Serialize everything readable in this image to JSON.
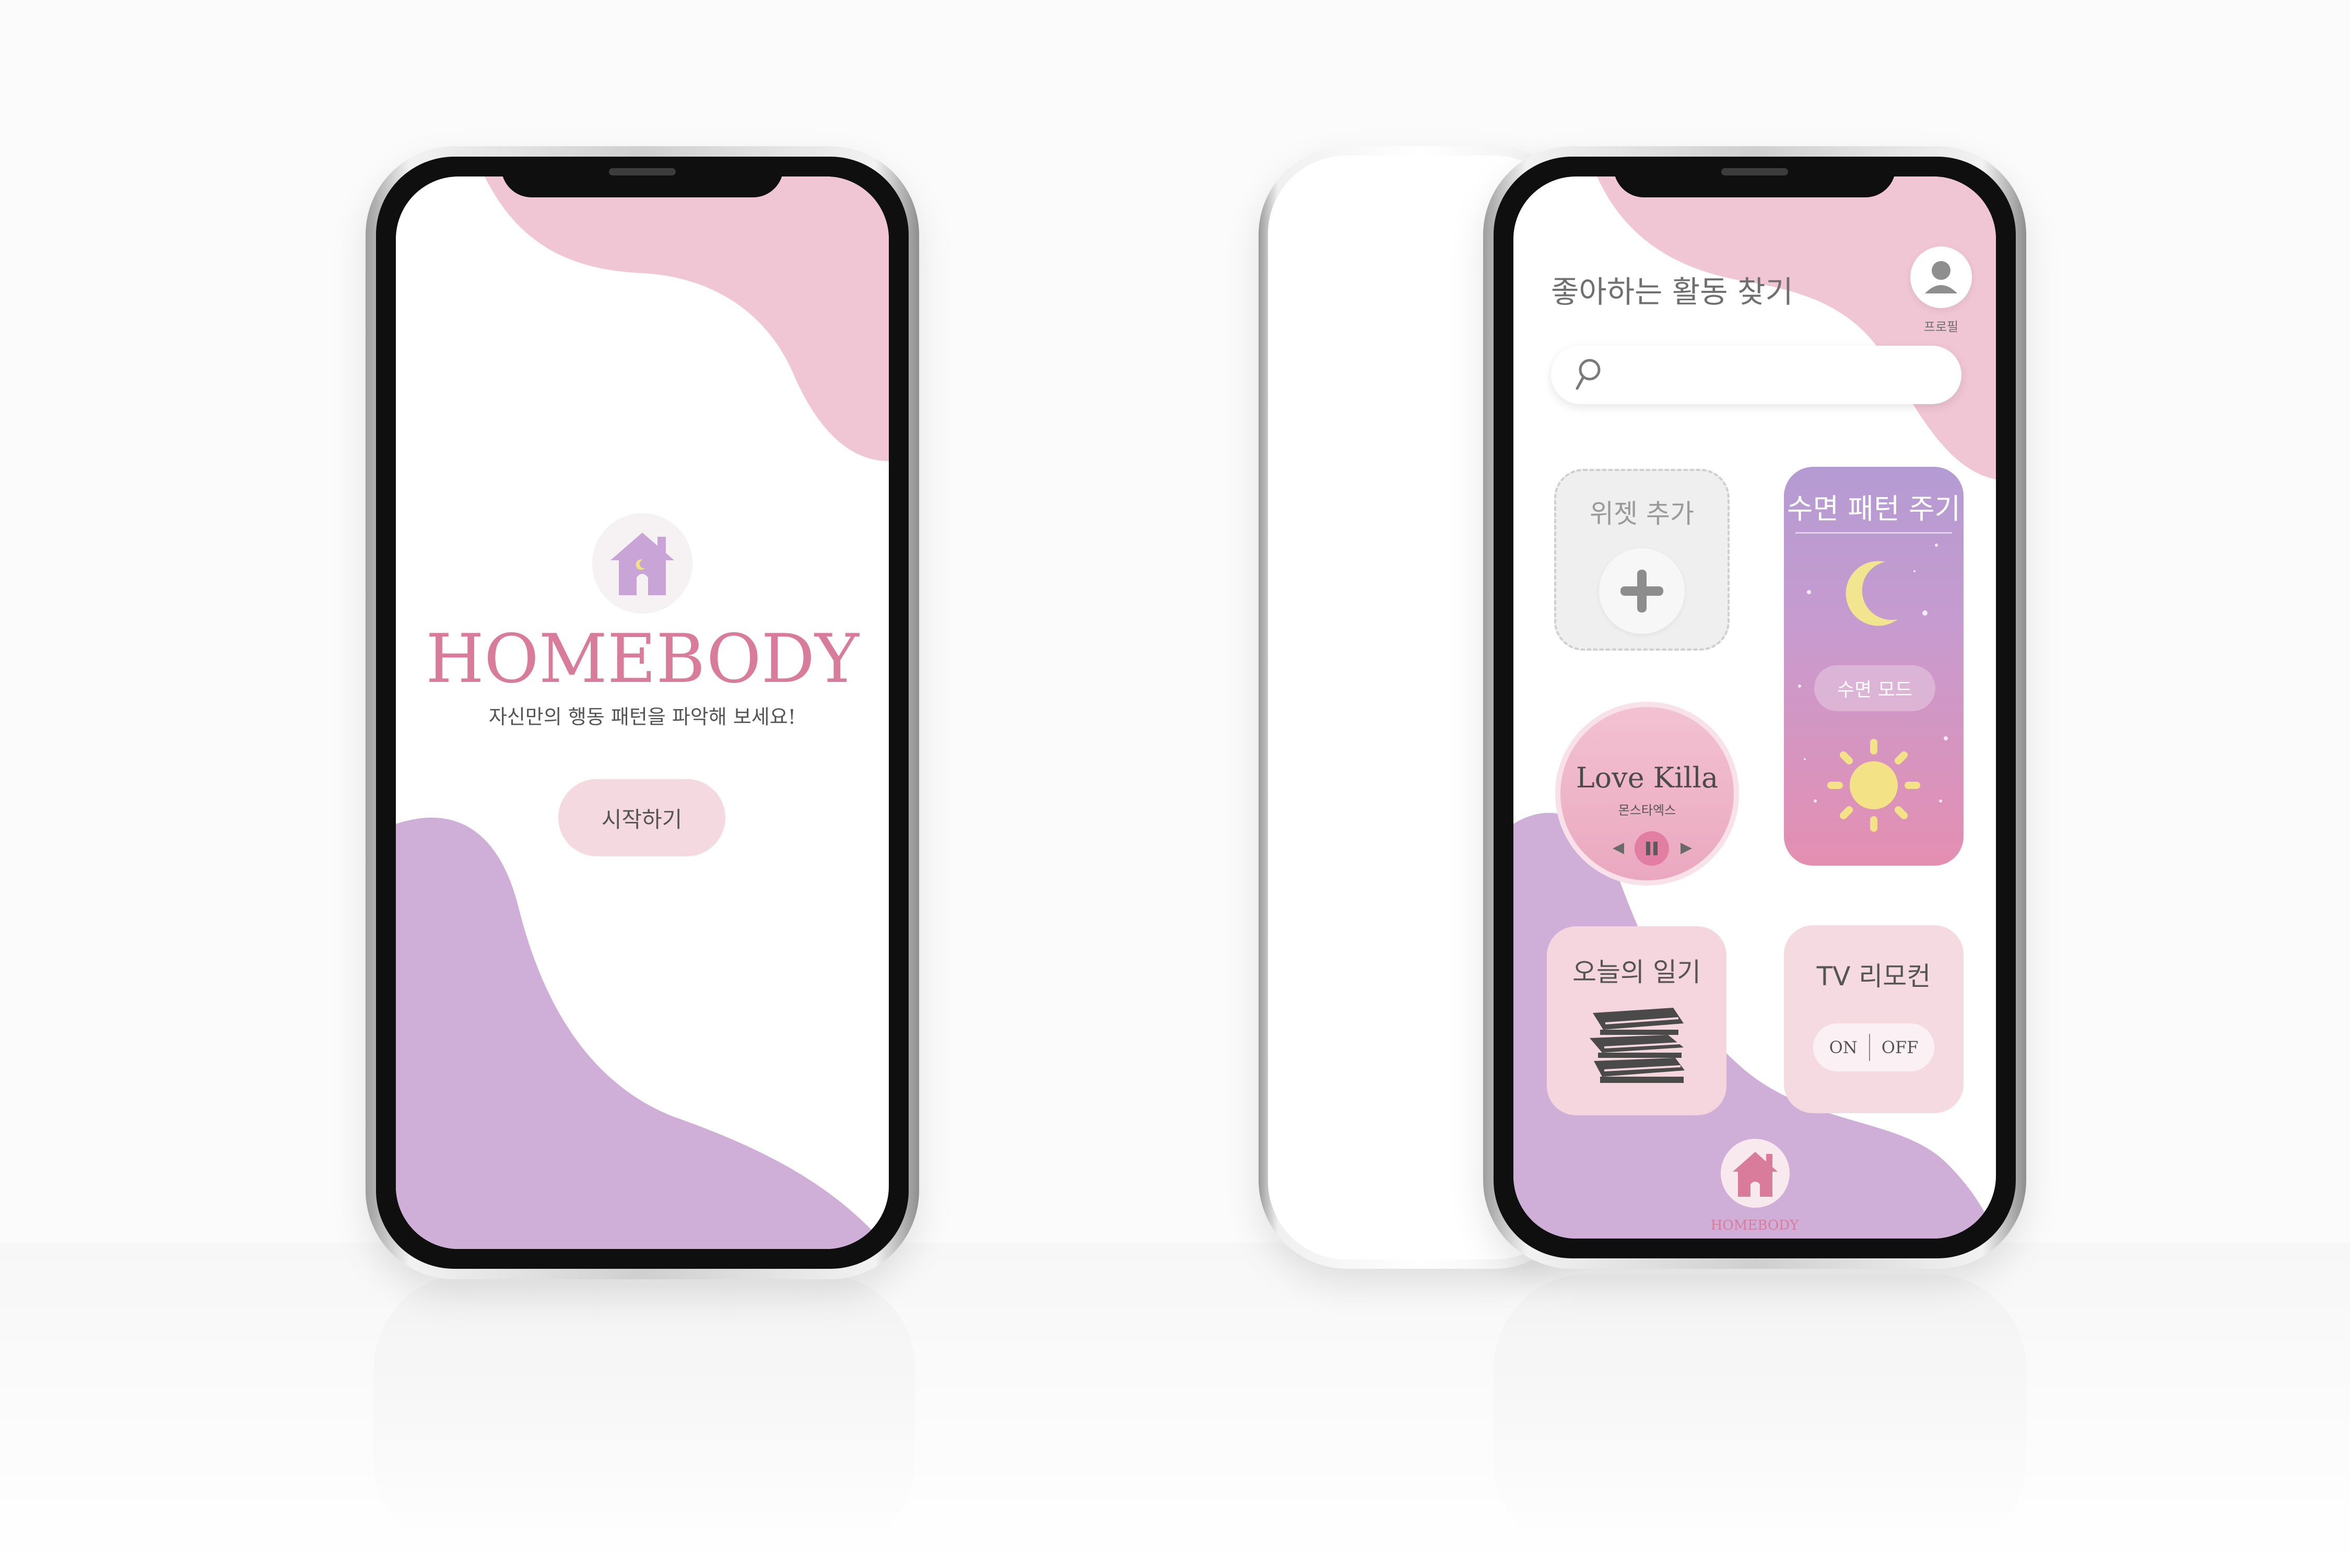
{
  "colors": {
    "pink_blob": "#f1c6d4",
    "purple_blob": "#cfaed8",
    "brand_pink": "#d97c9c",
    "logo_purple": "#c9a4d6"
  },
  "splash": {
    "brand": "HOMEBODY",
    "tagline": "자신만의 행동 패턴을 파악해 보세요!",
    "start_button": "시작하기",
    "logo_icon": "house-moon-icon"
  },
  "home": {
    "title": "좋아하는 활동 찾기",
    "profile_label": "프로필",
    "search_icon": "search-icon",
    "search_value": "",
    "widget_add": {
      "title": "위젯 추가",
      "icon": "plus-icon"
    },
    "sleep": {
      "title": "수면 패턴 주기",
      "mode_button": "수면 모드",
      "icons": [
        "moon-icon",
        "sun-icon"
      ]
    },
    "music": {
      "title": "Love Killa",
      "artist": "몬스타엑스",
      "controls": [
        "previous-icon",
        "pause-icon",
        "next-icon"
      ]
    },
    "diary": {
      "title": "오늘의 일기",
      "icon": "books-icon"
    },
    "tv": {
      "title": "TV 리모컨",
      "on": "ON",
      "off": "OFF"
    },
    "bottom_brand": "HOMEBODY"
  }
}
